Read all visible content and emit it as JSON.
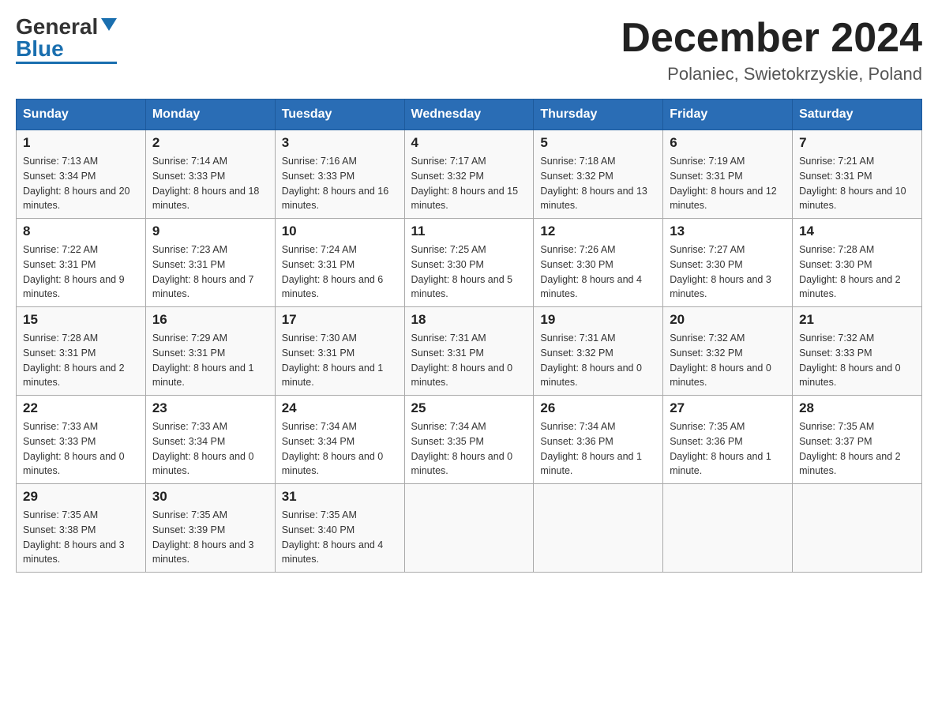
{
  "logo": {
    "general": "General",
    "blue": "Blue"
  },
  "title": "December 2024",
  "location": "Polaniec, Swietokrzyskie, Poland",
  "days_of_week": [
    "Sunday",
    "Monday",
    "Tuesday",
    "Wednesday",
    "Thursday",
    "Friday",
    "Saturday"
  ],
  "weeks": [
    [
      {
        "day": "1",
        "sunrise": "7:13 AM",
        "sunset": "3:34 PM",
        "daylight": "8 hours and 20 minutes."
      },
      {
        "day": "2",
        "sunrise": "7:14 AM",
        "sunset": "3:33 PM",
        "daylight": "8 hours and 18 minutes."
      },
      {
        "day": "3",
        "sunrise": "7:16 AM",
        "sunset": "3:33 PM",
        "daylight": "8 hours and 16 minutes."
      },
      {
        "day": "4",
        "sunrise": "7:17 AM",
        "sunset": "3:32 PM",
        "daylight": "8 hours and 15 minutes."
      },
      {
        "day": "5",
        "sunrise": "7:18 AM",
        "sunset": "3:32 PM",
        "daylight": "8 hours and 13 minutes."
      },
      {
        "day": "6",
        "sunrise": "7:19 AM",
        "sunset": "3:31 PM",
        "daylight": "8 hours and 12 minutes."
      },
      {
        "day": "7",
        "sunrise": "7:21 AM",
        "sunset": "3:31 PM",
        "daylight": "8 hours and 10 minutes."
      }
    ],
    [
      {
        "day": "8",
        "sunrise": "7:22 AM",
        "sunset": "3:31 PM",
        "daylight": "8 hours and 9 minutes."
      },
      {
        "day": "9",
        "sunrise": "7:23 AM",
        "sunset": "3:31 PM",
        "daylight": "8 hours and 7 minutes."
      },
      {
        "day": "10",
        "sunrise": "7:24 AM",
        "sunset": "3:31 PM",
        "daylight": "8 hours and 6 minutes."
      },
      {
        "day": "11",
        "sunrise": "7:25 AM",
        "sunset": "3:30 PM",
        "daylight": "8 hours and 5 minutes."
      },
      {
        "day": "12",
        "sunrise": "7:26 AM",
        "sunset": "3:30 PM",
        "daylight": "8 hours and 4 minutes."
      },
      {
        "day": "13",
        "sunrise": "7:27 AM",
        "sunset": "3:30 PM",
        "daylight": "8 hours and 3 minutes."
      },
      {
        "day": "14",
        "sunrise": "7:28 AM",
        "sunset": "3:30 PM",
        "daylight": "8 hours and 2 minutes."
      }
    ],
    [
      {
        "day": "15",
        "sunrise": "7:28 AM",
        "sunset": "3:31 PM",
        "daylight": "8 hours and 2 minutes."
      },
      {
        "day": "16",
        "sunrise": "7:29 AM",
        "sunset": "3:31 PM",
        "daylight": "8 hours and 1 minute."
      },
      {
        "day": "17",
        "sunrise": "7:30 AM",
        "sunset": "3:31 PM",
        "daylight": "8 hours and 1 minute."
      },
      {
        "day": "18",
        "sunrise": "7:31 AM",
        "sunset": "3:31 PM",
        "daylight": "8 hours and 0 minutes."
      },
      {
        "day": "19",
        "sunrise": "7:31 AM",
        "sunset": "3:32 PM",
        "daylight": "8 hours and 0 minutes."
      },
      {
        "day": "20",
        "sunrise": "7:32 AM",
        "sunset": "3:32 PM",
        "daylight": "8 hours and 0 minutes."
      },
      {
        "day": "21",
        "sunrise": "7:32 AM",
        "sunset": "3:33 PM",
        "daylight": "8 hours and 0 minutes."
      }
    ],
    [
      {
        "day": "22",
        "sunrise": "7:33 AM",
        "sunset": "3:33 PM",
        "daylight": "8 hours and 0 minutes."
      },
      {
        "day": "23",
        "sunrise": "7:33 AM",
        "sunset": "3:34 PM",
        "daylight": "8 hours and 0 minutes."
      },
      {
        "day": "24",
        "sunrise": "7:34 AM",
        "sunset": "3:34 PM",
        "daylight": "8 hours and 0 minutes."
      },
      {
        "day": "25",
        "sunrise": "7:34 AM",
        "sunset": "3:35 PM",
        "daylight": "8 hours and 0 minutes."
      },
      {
        "day": "26",
        "sunrise": "7:34 AM",
        "sunset": "3:36 PM",
        "daylight": "8 hours and 1 minute."
      },
      {
        "day": "27",
        "sunrise": "7:35 AM",
        "sunset": "3:36 PM",
        "daylight": "8 hours and 1 minute."
      },
      {
        "day": "28",
        "sunrise": "7:35 AM",
        "sunset": "3:37 PM",
        "daylight": "8 hours and 2 minutes."
      }
    ],
    [
      {
        "day": "29",
        "sunrise": "7:35 AM",
        "sunset": "3:38 PM",
        "daylight": "8 hours and 3 minutes."
      },
      {
        "day": "30",
        "sunrise": "7:35 AM",
        "sunset": "3:39 PM",
        "daylight": "8 hours and 3 minutes."
      },
      {
        "day": "31",
        "sunrise": "7:35 AM",
        "sunset": "3:40 PM",
        "daylight": "8 hours and 4 minutes."
      },
      null,
      null,
      null,
      null
    ]
  ]
}
